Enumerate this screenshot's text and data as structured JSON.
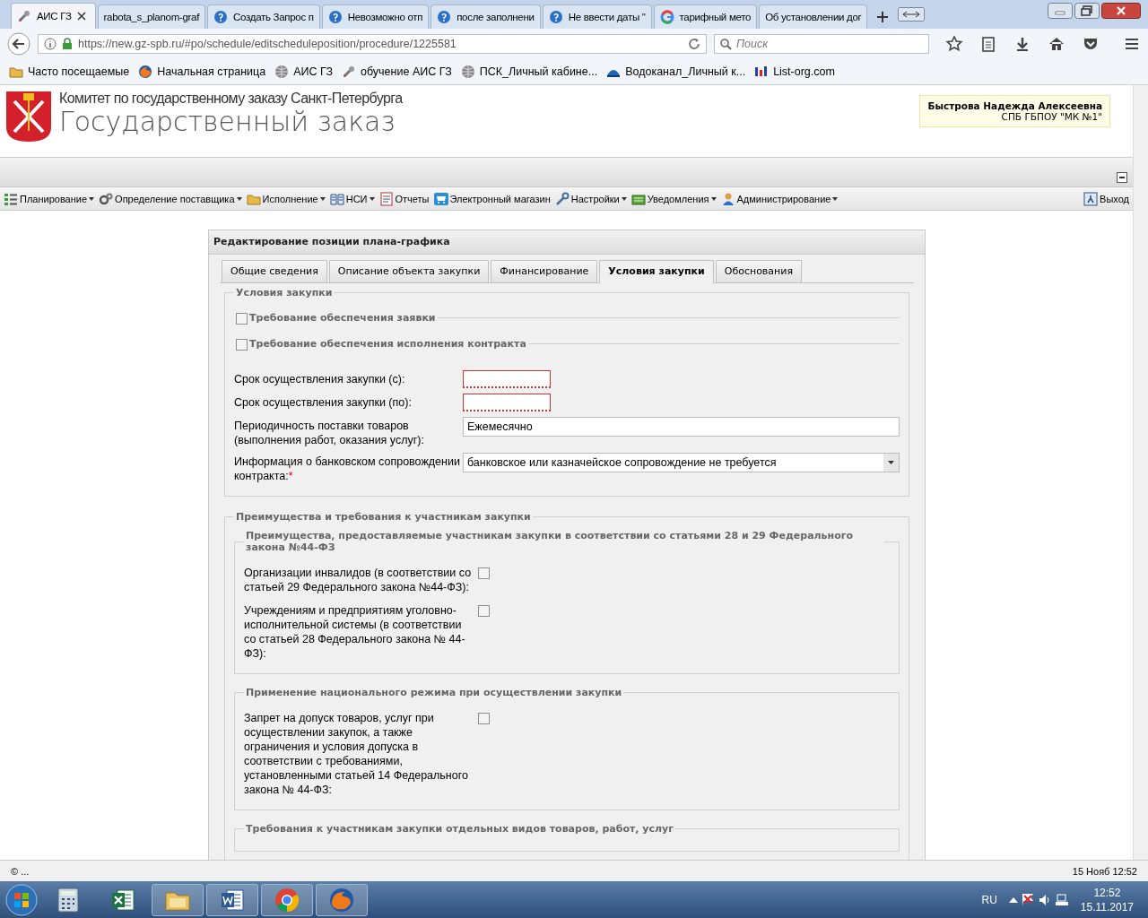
{
  "browser": {
    "tabs": [
      {
        "title": "АИС ГЗ",
        "kind": "tool",
        "selected": true
      },
      {
        "title": "rabota_s_planom-graf",
        "selected": false
      },
      {
        "title": "Создать Запрос п",
        "kind": "help",
        "selected": false
      },
      {
        "title": "Невозможно отп",
        "kind": "help",
        "selected": false
      },
      {
        "title": "после заполнени",
        "kind": "help",
        "selected": false
      },
      {
        "title": "Не ввести даты \"",
        "kind": "help",
        "selected": false
      },
      {
        "title": "тарифный мето",
        "kind": "google",
        "selected": false
      },
      {
        "title": "Об установлении дог",
        "selected": false
      }
    ],
    "url": "https://new.gz-spb.ru/#po/schedule/editscheduleposition/procedure/1225581",
    "search": {
      "placeholder": "Поиск"
    },
    "bookmarks": [
      {
        "label": "Часто посещаемые",
        "kind": "folder"
      },
      {
        "label": "Начальная страница",
        "kind": "fox"
      },
      {
        "label": "АИС ГЗ",
        "kind": "globe"
      },
      {
        "label": "обучение АИС ГЗ",
        "kind": "tool"
      },
      {
        "label": "ПСК_Личный кабине...",
        "kind": "globe"
      },
      {
        "label": "Водоканал_Личный к...",
        "kind": "dome"
      },
      {
        "label": "List-org.com",
        "kind": "bars"
      }
    ]
  },
  "header": {
    "org": "Комитет по государственному заказу Санкт-Петербурга",
    "title": "Государственный заказ",
    "user": {
      "name": "Быстрова Надежда Алексеевна",
      "org": "СПБ ГБПОУ \"МК №1\""
    }
  },
  "menu": [
    {
      "label": "Планирование",
      "kind": "list",
      "dropdown": true
    },
    {
      "label": "Определение поставщика",
      "kind": "gears",
      "dropdown": true
    },
    {
      "label": "Исполнение",
      "kind": "folder",
      "dropdown": true
    },
    {
      "label": "НСИ",
      "kind": "book",
      "dropdown": true
    },
    {
      "label": "Отчеты",
      "kind": "document",
      "dropdown": false
    },
    {
      "label": "Электронный магазин",
      "kind": "cart",
      "dropdown": false
    },
    {
      "label": "Настройки",
      "kind": "wrench",
      "dropdown": true
    },
    {
      "label": "Уведомления",
      "kind": "tray",
      "dropdown": true
    },
    {
      "label": "Администрирование",
      "kind": "person",
      "dropdown": true
    }
  ],
  "logout": "Выход",
  "panel": {
    "title": "Редактирование позиции плана-графика",
    "tabs": [
      {
        "label": "Общие сведения",
        "selected": false
      },
      {
        "label": "Описание объекта закупки",
        "selected": false
      },
      {
        "label": "Финансирование",
        "selected": false
      },
      {
        "label": "Условия закупки",
        "selected": true
      },
      {
        "label": "Обоснования",
        "selected": false
      }
    ],
    "sections": [
      {
        "legend": "Условия закупки",
        "items": [
          {
            "kind": "collapsed",
            "label": "Требование обеспечения заявки",
            "checked": false
          },
          {
            "kind": "collapsed",
            "label": "Требование обеспечения исполнения контракта",
            "checked": false
          },
          {
            "kind": "date",
            "label": "Срок осуществления закупки (с):",
            "invalid": true
          },
          {
            "kind": "date",
            "label": "Срок осуществления закупки (по):",
            "invalid": true
          },
          {
            "kind": "text",
            "label": "Периодичность поставки товаров (выполнения работ, оказания услуг):",
            "value": "Ежемесячно"
          },
          {
            "kind": "select",
            "label": "Информация о банковском сопровождении контракта:",
            "required_mark": "*",
            "value": "банковское или казначейское сопровождение не требуется"
          }
        ]
      },
      {
        "legend": "Преимущества и требования к участникам закупки",
        "items": [
          {
            "kind": "group",
            "legend": "Преимущества, предоставляемые участникам закупки в соответствии со статьями 28 и 29 Федерального закона №44-ФЗ",
            "rows": [
              {
                "label": "Организации инвалидов (в соответствии со статьей 29 Федерального закона №44-ФЗ):",
                "checked": false
              },
              {
                "label": "Учреждениям и предприятиям уголовно-исполнительной системы (в соответствии со статьей 28 Федерального закона № 44-ФЗ):",
                "checked": false
              }
            ]
          },
          {
            "kind": "group",
            "legend": "Применение национального режима при осуществлении закупки",
            "rows": [
              {
                "label": "Запрет на допуск товаров, услуг при осуществлении закупок, а также ограничения и условия допуска в соответствии с требованиями, установленными статьей 14 Федерального закона № 44-ФЗ:",
                "checked": false
              }
            ]
          },
          {
            "kind": "group",
            "legend": "Требования к участникам закупки отдельных видов товаров, работ, услуг"
          }
        ]
      }
    ]
  },
  "status_bar": {
    "left": "© ...",
    "right": "15 Нояб 12:52"
  },
  "taskbar": {
    "apps": [
      {
        "kind": "calculator",
        "running": false
      },
      {
        "kind": "excel",
        "running": false
      },
      {
        "kind": "explorer",
        "running": true
      },
      {
        "kind": "word",
        "running": true
      },
      {
        "kind": "chrome",
        "running": true
      },
      {
        "kind": "firefox",
        "running": true
      }
    ],
    "language": "RU",
    "time": "12:52",
    "date": "15.11.2017"
  }
}
